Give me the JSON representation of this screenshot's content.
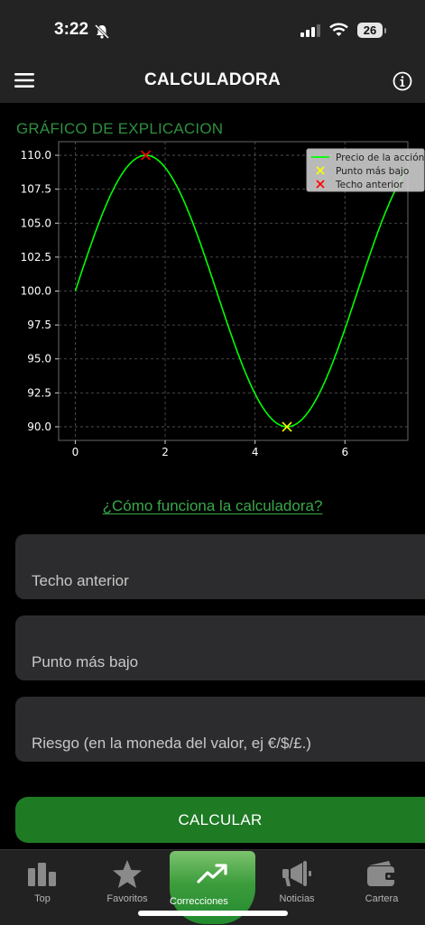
{
  "status_bar": {
    "time": "3:22",
    "battery": "26"
  },
  "header": {
    "title": "CALCULADORA"
  },
  "chart_title": "GRÁFICO DE EXPLICACION",
  "chart_data": {
    "type": "line",
    "title": "",
    "xlabel": "",
    "ylabel": "",
    "xlim": [
      -0.37,
      7.4
    ],
    "ylim": [
      89.0,
      111.0
    ],
    "x_ticks": [
      0,
      2,
      4,
      6
    ],
    "y_ticks": [
      90.0,
      92.5,
      95.0,
      97.5,
      100.0,
      102.5,
      105.0,
      107.5,
      110.0
    ],
    "x_tick_labels": [
      "0",
      "2",
      "4",
      "6"
    ],
    "y_tick_labels": [
      "90.0",
      "92.5",
      "95.0",
      "97.5",
      "100.0",
      "102.5",
      "105.0",
      "107.5",
      "110.0"
    ],
    "grid": true,
    "legend_position": "top-right",
    "series": [
      {
        "name": "Precio de la acción",
        "type": "line",
        "color": "#00ff00",
        "function": "100 + 10*sin(x)",
        "x_range": [
          0,
          7.4
        ]
      },
      {
        "name": "Punto más bajo",
        "type": "scatter",
        "marker": "x",
        "color": "#ffff00",
        "points": [
          [
            4.71,
            90.0
          ]
        ]
      },
      {
        "name": "Techo anterior",
        "type": "scatter",
        "marker": "x",
        "color": "#ff0000",
        "points": [
          [
            1.57,
            110.0
          ]
        ]
      }
    ]
  },
  "link_text": "¿Cómo funciona la calculadora?",
  "fields": {
    "previous_high": {
      "placeholder": "Techo anterior",
      "value": ""
    },
    "lowest_point": {
      "placeholder": "Punto más bajo",
      "value": ""
    },
    "risk": {
      "placeholder": "Riesgo (en la moneda del valor, ej €/$/£.)",
      "value": ""
    }
  },
  "calculate_label": "CALCULAR",
  "tabs": [
    {
      "label": "Top",
      "icon": "bar-chart-icon"
    },
    {
      "label": "Favoritos",
      "icon": "star-icon"
    },
    {
      "label": "Correcciones",
      "icon": "trend-up-icon",
      "active": true
    },
    {
      "label": "Noticias",
      "icon": "megaphone-icon"
    },
    {
      "label": "Cartera",
      "icon": "wallet-icon"
    }
  ],
  "colors": {
    "accent": "#1f7a24",
    "link": "#38a84a",
    "line": "#00ff00",
    "low_marker": "#ffff00",
    "high_marker": "#ff0000"
  }
}
